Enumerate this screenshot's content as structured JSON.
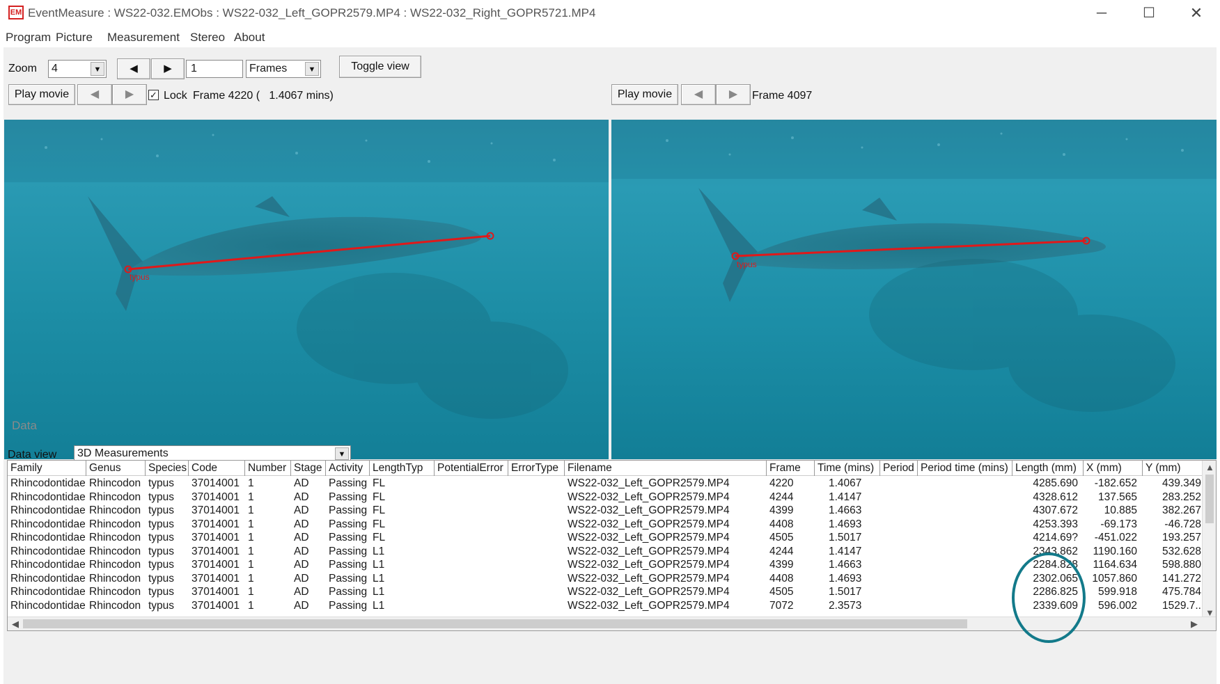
{
  "window": {
    "icon_text": "EM",
    "title": "EventMeasure : WS22-032.EMObs : WS22-032_Left_GOPR2579.MP4 : WS22-032_Right_GOPR5721.MP4",
    "minimize_glyph": "─",
    "maximize_glyph": "☐",
    "close_glyph": "✕"
  },
  "menu": [
    "Program",
    "Picture",
    "Measurement",
    "Stereo",
    "About"
  ],
  "toolbar": {
    "zoom_label": "Zoom",
    "zoom_value": "4",
    "prev_glyph": "◀",
    "next_glyph": "▶",
    "step_value": "1",
    "step_unit": "Frames",
    "toggle_view": "Toggle view"
  },
  "left_view": {
    "play_movie": "Play movie",
    "lock_label": "Lock",
    "lock_checked": true,
    "frame_text": "Frame 4220 (   1.4067 mins)",
    "measure_label": "typus"
  },
  "right_view": {
    "play_movie": "Play movie",
    "frame_text": "Frame 4097",
    "measure_label": "typus"
  },
  "data_panel": {
    "title": "Data",
    "data_view_label": "Data view",
    "data_view_value": "3D Measurements",
    "columns": [
      "Family",
      "Genus",
      "Species",
      "Code",
      "Number",
      "Stage",
      "Activity",
      "LengthTyp",
      "PotentialError",
      "ErrorType",
      "Filename",
      "Frame",
      "Time (mins)",
      "Period",
      "Period time (mins)",
      "Length (mm)",
      "X (mm)",
      "Y (mm)"
    ],
    "rows": [
      [
        "Rhincodontidae",
        "Rhincodon",
        "typus",
        "37014001",
        "1",
        "AD",
        "Passing",
        "FL",
        "",
        "",
        "WS22-032_Left_GOPR2579.MP4",
        "4220",
        "1.4067",
        "",
        "",
        "4285.690",
        "-182.652",
        "439.349"
      ],
      [
        "Rhincodontidae",
        "Rhincodon",
        "typus",
        "37014001",
        "1",
        "AD",
        "Passing",
        "FL",
        "",
        "",
        "WS22-032_Left_GOPR2579.MP4",
        "4244",
        "1.4147",
        "",
        "",
        "4328.612",
        "137.565",
        "283.252"
      ],
      [
        "Rhincodontidae",
        "Rhincodon",
        "typus",
        "37014001",
        "1",
        "AD",
        "Passing",
        "FL",
        "",
        "",
        "WS22-032_Left_GOPR2579.MP4",
        "4399",
        "1.4663",
        "",
        "",
        "4307.672",
        "10.885",
        "382.267"
      ],
      [
        "Rhincodontidae",
        "Rhincodon",
        "typus",
        "37014001",
        "1",
        "AD",
        "Passing",
        "FL",
        "",
        "",
        "WS22-032_Left_GOPR2579.MP4",
        "4408",
        "1.4693",
        "",
        "",
        "4253.393",
        "-69.173",
        "-46.728"
      ],
      [
        "Rhincodontidae",
        "Rhincodon",
        "typus",
        "37014001",
        "1",
        "AD",
        "Passing",
        "FL",
        "",
        "",
        "WS22-032_Left_GOPR2579.MP4",
        "4505",
        "1.5017",
        "",
        "",
        "4214.69?",
        "-451.022",
        "193.257"
      ],
      [
        "Rhincodontidae",
        "Rhincodon",
        "typus",
        "37014001",
        "1",
        "AD",
        "Passing",
        "L1",
        "",
        "",
        "WS22-032_Left_GOPR2579.MP4",
        "4244",
        "1.4147",
        "",
        "",
        "2343.862",
        "1190.160",
        "532.628"
      ],
      [
        "Rhincodontidae",
        "Rhincodon",
        "typus",
        "37014001",
        "1",
        "AD",
        "Passing",
        "L1",
        "",
        "",
        "WS22-032_Left_GOPR2579.MP4",
        "4399",
        "1.4663",
        "",
        "",
        "2284.828",
        "1164.634",
        "598.880"
      ],
      [
        "Rhincodontidae",
        "Rhincodon",
        "typus",
        "37014001",
        "1",
        "AD",
        "Passing",
        "L1",
        "",
        "",
        "WS22-032_Left_GOPR2579.MP4",
        "4408",
        "1.4693",
        "",
        "",
        "2302.065",
        "1057.860",
        "141.272"
      ],
      [
        "Rhincodontidae",
        "Rhincodon",
        "typus",
        "37014001",
        "1",
        "AD",
        "Passing",
        "L1",
        "",
        "",
        "WS22-032_Left_GOPR2579.MP4",
        "4505",
        "1.5017",
        "",
        "",
        "2286.825",
        "599.918",
        "475.784"
      ],
      [
        "Rhincodontidae",
        "Rhincodon",
        "typus",
        "37014001",
        "1",
        "AD",
        "Passing",
        "L1",
        "",
        "",
        "WS22-032_Left_GOPR2579.MP4",
        "7072",
        "2.3573",
        "",
        "",
        "2339.609",
        "596.002",
        "1529.7.."
      ]
    ]
  },
  "colors": {
    "measure_line": "#e0191a",
    "highlight": "#137a8a",
    "water_top": "#2e8ea4",
    "water_bottom": "#127d95"
  }
}
